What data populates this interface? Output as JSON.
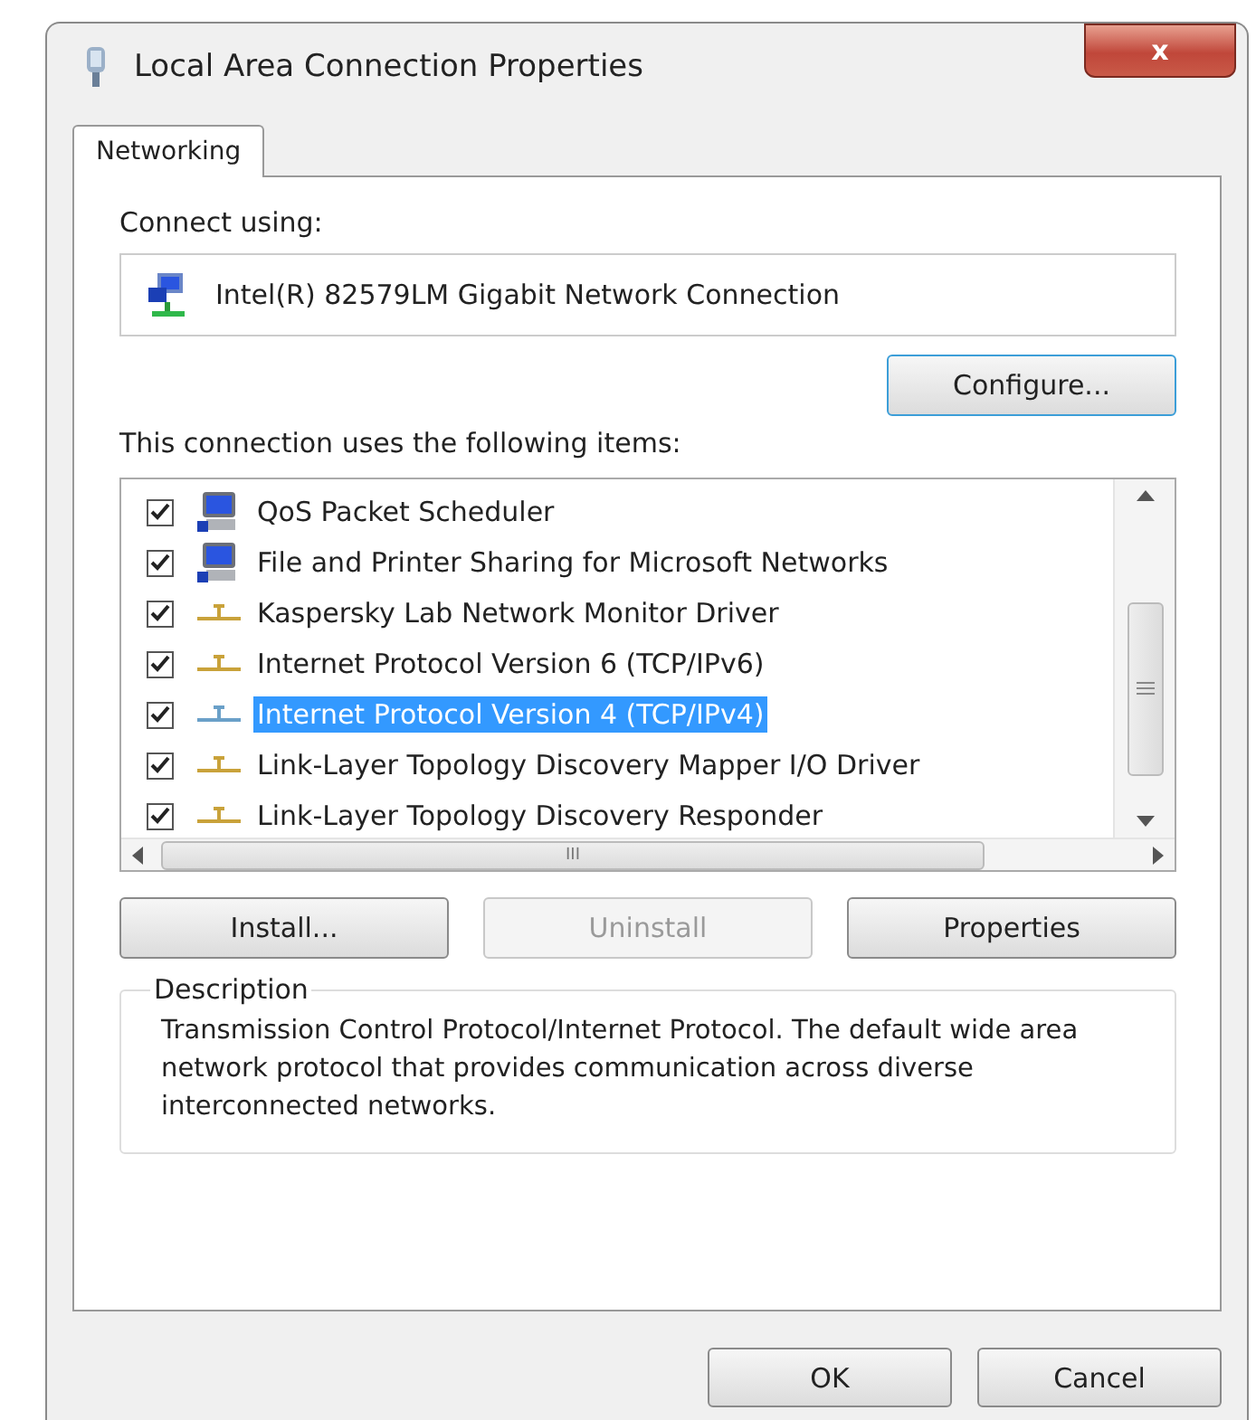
{
  "window": {
    "title": "Local Area Connection Properties",
    "close": "x"
  },
  "tabs": [
    {
      "label": "Networking",
      "selected": true
    }
  ],
  "connect_using": {
    "label": "Connect using:",
    "adapter": "Intel(R) 82579LM Gigabit Network Connection"
  },
  "configure_button": "Configure...",
  "items_label": "This connection uses the following items:",
  "items": [
    {
      "kind": "computer",
      "label": "QoS Packet Scheduler",
      "checked": true,
      "selected": false
    },
    {
      "kind": "computer",
      "label": "File and Printer Sharing for Microsoft Networks",
      "checked": true,
      "selected": false
    },
    {
      "kind": "protocol",
      "label": "Kaspersky Lab Network Monitor Driver",
      "checked": true,
      "selected": false
    },
    {
      "kind": "protocol",
      "label": "Internet Protocol Version 6 (TCP/IPv6)",
      "checked": true,
      "selected": false
    },
    {
      "kind": "protocol",
      "label": "Internet Protocol Version 4 (TCP/IPv4)",
      "checked": true,
      "selected": true
    },
    {
      "kind": "protocol",
      "label": "Link-Layer Topology Discovery Mapper I/O Driver",
      "checked": true,
      "selected": false
    },
    {
      "kind": "protocol",
      "label": "Link-Layer Topology Discovery Responder",
      "checked": true,
      "selected": false
    }
  ],
  "scroll_grip": "III",
  "item_buttons": [
    {
      "label": "Install...",
      "disabled": false
    },
    {
      "label": "Uninstall",
      "disabled": true
    },
    {
      "label": "Properties",
      "disabled": false
    }
  ],
  "description": {
    "title": "Description",
    "text": "Transmission Control Protocol/Internet Protocol. The default wide area network protocol that provides communication across diverse interconnected networks."
  },
  "dialog_buttons": [
    {
      "label": "OK"
    },
    {
      "label": "Cancel"
    }
  ]
}
